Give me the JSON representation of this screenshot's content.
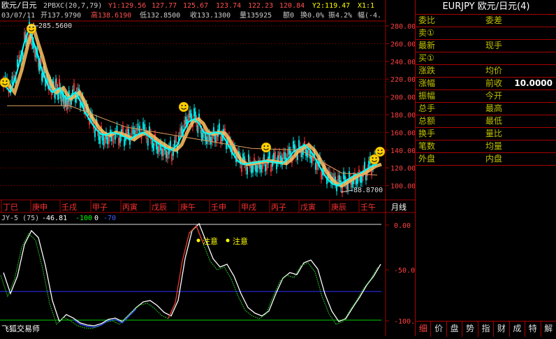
{
  "header": {
    "title": "欧元/日元",
    "indicator": "2PBXC(20,7,79)",
    "y1": "Y1:129.56",
    "y2a": "127.77",
    "y3": "125.67",
    "y4": "123.74",
    "y5": "122.23",
    "y6": "120.84",
    "y7": "Y2:119.47",
    "y8": "X1:1"
  },
  "quote_line": {
    "date": "03/07/11",
    "open": "开137.9790",
    "high": "高138.6190",
    "low": "低132.8500",
    "close": "收133.1300",
    "volume": "量135925",
    "amount": "额0",
    "turnover": "换0.0%",
    "amplitude": "振4.2%",
    "change": "幅(-4."
  },
  "price_axis": [
    "280.00",
    "260.00",
    "240.00",
    "220.00",
    "200.00",
    "180.00",
    "160.00",
    "140.00",
    "120.00",
    "100.00"
  ],
  "annotations": {
    "peak": "285.5600",
    "trough": "88.8700"
  },
  "time_axis": [
    "丁巳",
    "庚申",
    "壬戌",
    "甲子",
    "丙寅",
    "戊辰",
    "庚午",
    "壬申",
    "甲戌",
    "丙子",
    "戊寅",
    "庚辰",
    "壬午"
  ],
  "period": "月线",
  "sub": {
    "name": "JY-5 (75)",
    "value": "-46.81",
    "l1": "-100",
    "l2": "0",
    "l3": "-70",
    "axis": [
      "0.00",
      "-50.00",
      "-100.00"
    ],
    "note1": "注意",
    "note2": "注意"
  },
  "watermark": "飞狐交易师",
  "panel": {
    "symbol": "EURJPY",
    "name": "欧元/日元",
    "count": "(4)",
    "rows": [
      {
        "a": "委比",
        "b": "委差",
        "v": ""
      },
      {
        "a": "卖①",
        "b": "",
        "v": ""
      },
      {
        "a": "最新",
        "b": "现手",
        "v": ""
      },
      {
        "a": "买①",
        "b": "",
        "v": ""
      },
      {
        "a": "涨跌",
        "b": "均价",
        "v": ""
      },
      {
        "a": "涨幅",
        "b": "前收",
        "v": "10.0000"
      },
      {
        "a": "振幅",
        "b": "今开",
        "v": ""
      },
      {
        "a": "总手",
        "b": "最高",
        "v": ""
      },
      {
        "a": "总额",
        "b": "最低",
        "v": ""
      },
      {
        "a": "换手",
        "b": "量比",
        "v": ""
      },
      {
        "a": "笔数",
        "b": "均量",
        "v": ""
      },
      {
        "a": "外盘",
        "b": "内盘",
        "v": ""
      }
    ],
    "tabs": [
      "细",
      "价",
      "盘",
      "势",
      "指",
      "财",
      "成",
      "特",
      "解"
    ]
  },
  "colors": {
    "up": "#ff3030",
    "down": "#00e0e0",
    "grid": "#a00000",
    "ma1": "#00ffff",
    "ma2": "#ffc060"
  }
}
